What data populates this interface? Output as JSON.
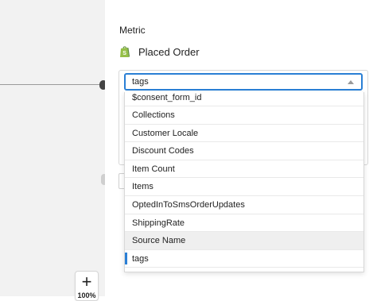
{
  "canvas": {
    "zoom_label": "100%"
  },
  "panel": {
    "metric_label": "Metric",
    "metric_name": "Placed Order",
    "metric_icon": "shopify-icon"
  },
  "select": {
    "value": "tags"
  },
  "dropdown": {
    "options": [
      "$consent_form_id",
      "Collections",
      "Customer Locale",
      "Discount Codes",
      "Item Count",
      "Items",
      "OptedInToSmsOrderUpdates",
      "ShippingRate",
      "Source Name",
      "tags"
    ],
    "hovered": "Source Name",
    "selected": "tags"
  },
  "colors": {
    "accent": "#2a7fd5",
    "shopify_green": "#95bf47"
  }
}
